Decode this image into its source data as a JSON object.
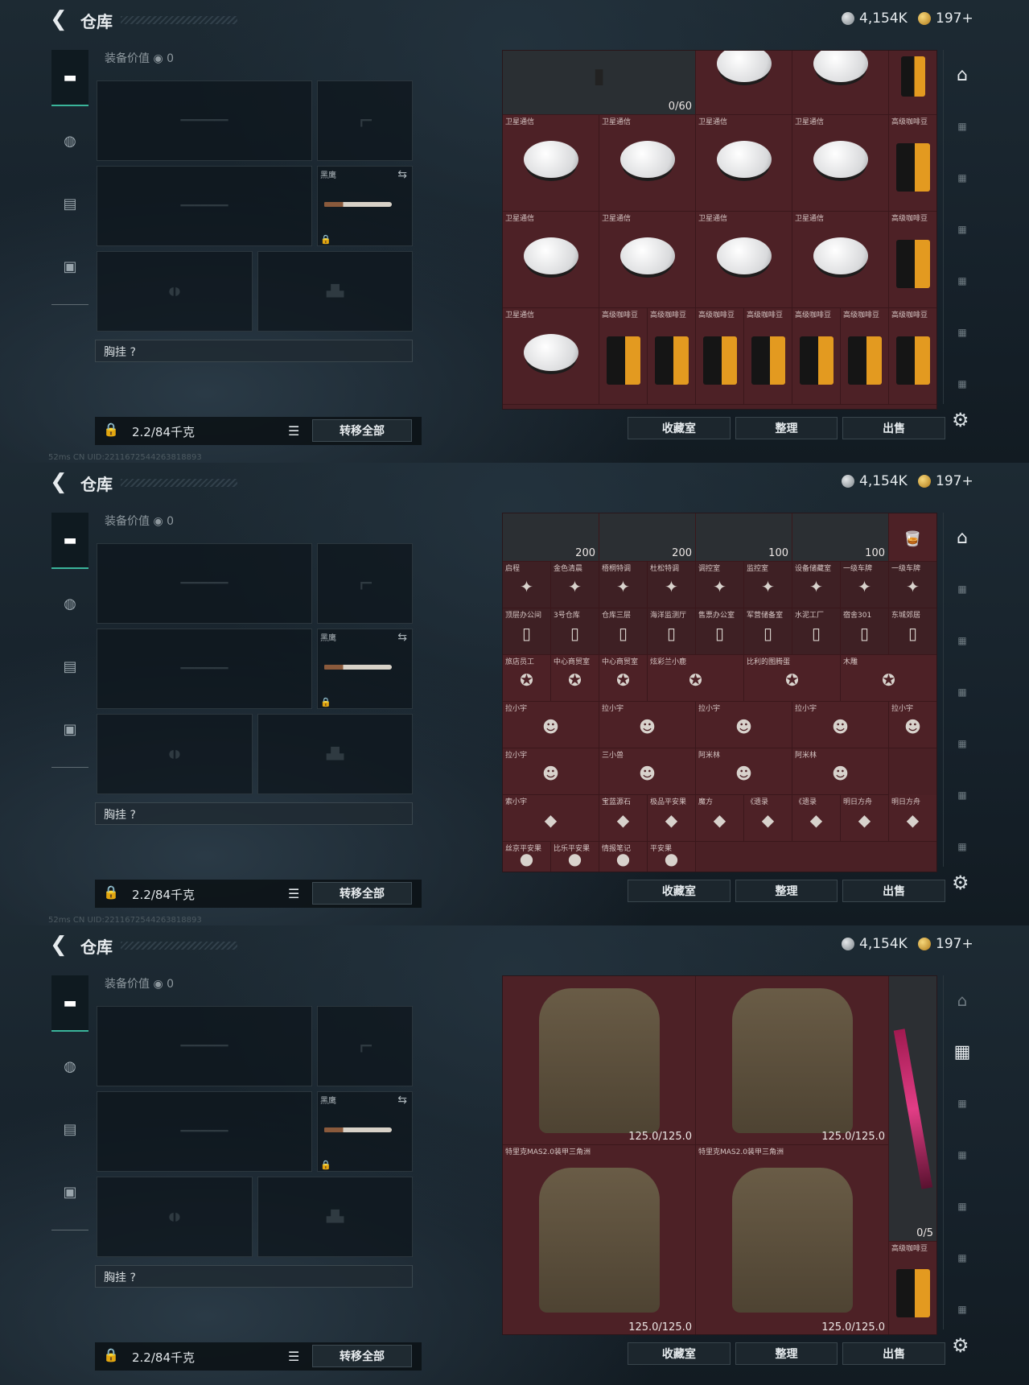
{
  "app": {
    "back_icon": "back-arrow-icon",
    "title": "仓库",
    "silver": "4,154K",
    "gold": "197+"
  },
  "loadout": {
    "value_label": "装备价值",
    "value": "0",
    "melee_name": "黑鹰",
    "chest_label": "胸挂 ?",
    "weight": "2.2/84千克",
    "transfer_all": "转移全部"
  },
  "footer": {
    "collection": "收藏室",
    "organize": "整理",
    "sell": "出售"
  },
  "screens": [
    {
      "id": "screen1",
      "grid_items": [
        {
          "name": "",
          "value": "0/60",
          "art": "tool"
        },
        {
          "name": "卫星通信",
          "value": "",
          "art": "dish"
        },
        {
          "name": "高级咖啡豆",
          "value": "",
          "art": "bag"
        }
      ],
      "satellite": "卫星通信",
      "coffee": "高级咖啡豆"
    },
    {
      "id": "screen2",
      "values": [
        "200",
        "200",
        "100",
        "100"
      ],
      "row1": [
        "启程",
        "金色清晨",
        "梧桐特调",
        "杜松特调",
        "调控室",
        "监控室",
        "设备储藏室",
        "一级车牌",
        "一级车牌"
      ],
      "row2": [
        "顶层办公间",
        "3号仓库",
        "仓库三层",
        "海洋监测厅",
        "售票办公室",
        "军营储备室",
        "水泥工厂",
        "宿舍301",
        "东城郊居"
      ],
      "row3": [
        "旅店员工",
        "中心商贸室",
        "中心商贸室",
        "炫彩兰小鹿",
        "比利的图腾蛋",
        "木雕"
      ],
      "row4": [
        "拉小宇",
        "拉小宇",
        "拉小宇",
        "拉小宇",
        "拉小宇"
      ],
      "row5": [
        "拉小宇",
        "三小兽",
        "阿米林",
        "阿米林"
      ],
      "row6": [
        "索小宇",
        "宝蓝源石",
        "极品平安果",
        "魔方",
        "《遗录",
        "《遗录",
        "明日方舟",
        "明日方舟"
      ],
      "row7": [
        "丝京平安果",
        "比乐平安果",
        "情报笔记",
        "平安果"
      ]
    },
    {
      "id": "screen3",
      "vest_value": "125.0/125.0",
      "vest_name": "特里克MAS2.0装甲三角洲",
      "rifle_value": "0/5",
      "coffee": "高级咖啡豆"
    }
  ],
  "status_bar": "52ms    CN UID:2211672544263818893"
}
